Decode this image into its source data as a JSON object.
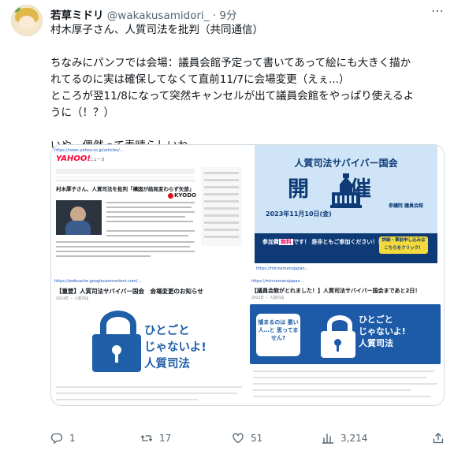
{
  "author": {
    "name": "若草ミドリ",
    "handle": "@wakakusamidori_",
    "separator": "·",
    "time": "9分"
  },
  "tweet_lines": [
    "村木厚子さん、人質司法を批判（共同通信）",
    "",
    "ちなみにパンフでは会場：議員会館予定って書いてあって絵にも大きく描か",
    "れてるのに実は確保してなくて直前11/7に会場変更（えぇ...）",
    "ところが翌11/8になって突然キャンセルが出て議員会館をやっぱり使えるよ",
    "うに（！？）",
    "",
    "いやー偶然って素晴らしいね"
  ],
  "media": {
    "yahoo": {
      "logo": "YAHOO!",
      "logo_sub": "ニュース",
      "headline": "村木厚子さん、人質司法を批判「構図が結局変わらず矢部」",
      "source": "KYODO"
    },
    "poster": {
      "title": "人質司法サバイバー国会",
      "kaisai": "開催",
      "date": "2023年11月10日(金)",
      "venue": "参議院 議員会館",
      "free_prefix": "参加費",
      "free": "無料",
      "free_suffix": "です！ 是非ともご参加ください！！",
      "button": "詳細・事前申し込みは こちらをクリック！"
    },
    "notice": {
      "title": "【重要】人質司法サバイバー国会　会場変更のお知らせ",
      "banner_line1": "ひとごと",
      "banner_line2": "じゃないよ!",
      "banner_line3": "人質司法"
    },
    "announce": {
      "title": "【議員会館がとれました！】人質司法サバイバー国会まであと2日！",
      "ask": "捕まるのは 悪い人…と 思ってません?",
      "banner_line1": "ひとごと",
      "banner_line2": "じゃないよ!",
      "banner_line3": "人質司法"
    }
  },
  "actions": {
    "replies": "1",
    "retweets": "17",
    "likes": "51",
    "views": "3,214"
  },
  "colors": {
    "accent": "#1d9bf0",
    "poster_blue": "#0e3a76",
    "banner_blue": "#1d5ba8",
    "muted": "#536471"
  }
}
